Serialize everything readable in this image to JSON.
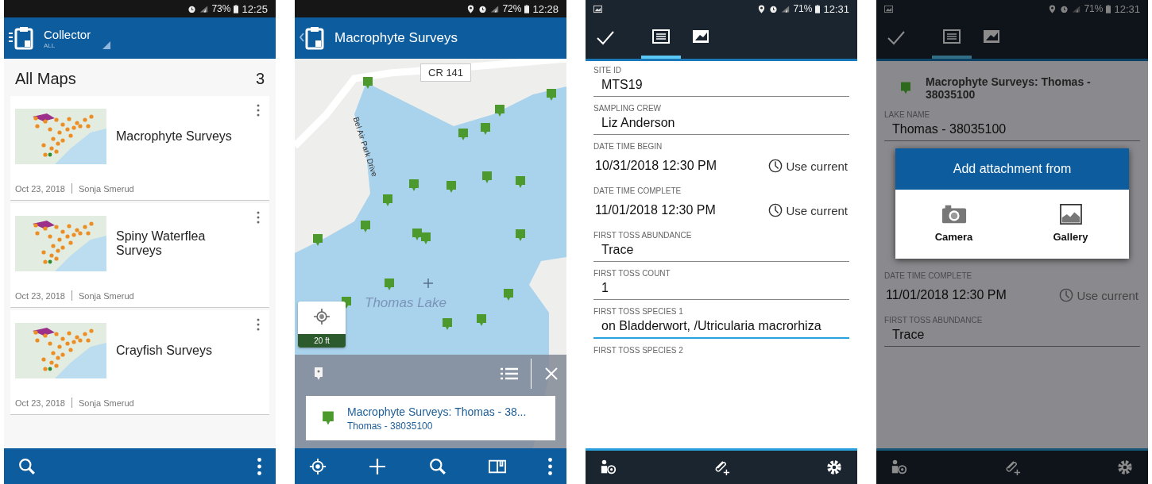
{
  "phones": [
    {
      "kind": "maps",
      "status": {
        "battery": "73%",
        "time": "12:25",
        "location": false,
        "notification": false
      },
      "app_bar": {
        "title": "Collector",
        "subtitle": "ALL"
      },
      "heading": "All Maps",
      "count": "3",
      "maps": [
        {
          "title": "Macrophyte Surveys",
          "date": "Oct 23, 2018",
          "owner": "Sonja Smerud"
        },
        {
          "title": "Spiny Waterflea Surveys",
          "date": "Oct 23, 2018",
          "owner": "Sonja Smerud"
        },
        {
          "title": "Crayfish Surveys",
          "date": "Oct 23, 2018",
          "owner": "Sonja Smerud"
        }
      ]
    },
    {
      "kind": "map",
      "status": {
        "battery": "72%",
        "time": "12:28",
        "location": true,
        "notification": false
      },
      "title": "Macrophyte Surveys",
      "road": "CR 141",
      "street": "Bel Air Park Drive",
      "lake": "Thomas Lake",
      "scale": "20 ft",
      "result": {
        "title": "Macrophyte Surveys: Thomas - 38...",
        "subtitle": "Thomas - 38035100"
      }
    },
    {
      "kind": "form",
      "dimmed": false,
      "status": {
        "battery": "71%",
        "time": "12:31",
        "location": true,
        "notification": true
      },
      "tabs": [
        {
          "kind": "details",
          "selected": true
        },
        {
          "kind": "map",
          "selected": false
        }
      ],
      "fields": [
        {
          "kind": "text",
          "label": "SITE ID",
          "value": "MTS19",
          "focused": false
        },
        {
          "kind": "text",
          "label": "SAMPLING CREW",
          "value": "Liz Anderson",
          "focused": false
        },
        {
          "kind": "datetime",
          "label": "DATE TIME BEGIN",
          "value": "10/31/2018 12:30 PM",
          "action": "Use current"
        },
        {
          "kind": "datetime",
          "label": "DATE TIME COMPLETE",
          "value": "11/01/2018 12:30 PM",
          "action": "Use current"
        },
        {
          "kind": "text",
          "label": "FIRST TOSS ABUNDANCE",
          "value": "Trace",
          "focused": false
        },
        {
          "kind": "text",
          "label": "FIRST TOSS COUNT",
          "value": "1",
          "focused": false
        },
        {
          "kind": "text",
          "label": "FIRST TOSS SPECIES 1",
          "value": "on Bladderwort, /Utricularia macrorhiza",
          "focused": true
        },
        {
          "kind": "label",
          "label": "FIRST TOSS SPECIES 2"
        }
      ]
    },
    {
      "kind": "form",
      "dimmed": true,
      "status": {
        "battery": "71%",
        "time": "12:31",
        "location": true,
        "notification": true
      },
      "tabs": [
        {
          "kind": "details",
          "selected": true
        },
        {
          "kind": "map",
          "selected": false
        }
      ],
      "feature": {
        "title": "Macrophyte Surveys: Thomas - 38035100"
      },
      "fields": [
        {
          "kind": "text",
          "label": "LAKE NAME",
          "value": "Thomas - 38035100",
          "focused": false
        },
        {
          "kind": "dialog",
          "title": "Add attachment from",
          "options": [
            {
              "kind": "camera",
              "label": "Camera"
            },
            {
              "kind": "gallery",
              "label": "Gallery"
            }
          ]
        },
        {
          "kind": "datetime",
          "label": "DATE TIME COMPLETE",
          "value": "11/01/2018 12:30 PM",
          "action": "Use current"
        },
        {
          "kind": "text",
          "label": "FIRST TOSS ABUNDANCE",
          "value": "Trace",
          "focused": false
        }
      ]
    }
  ]
}
